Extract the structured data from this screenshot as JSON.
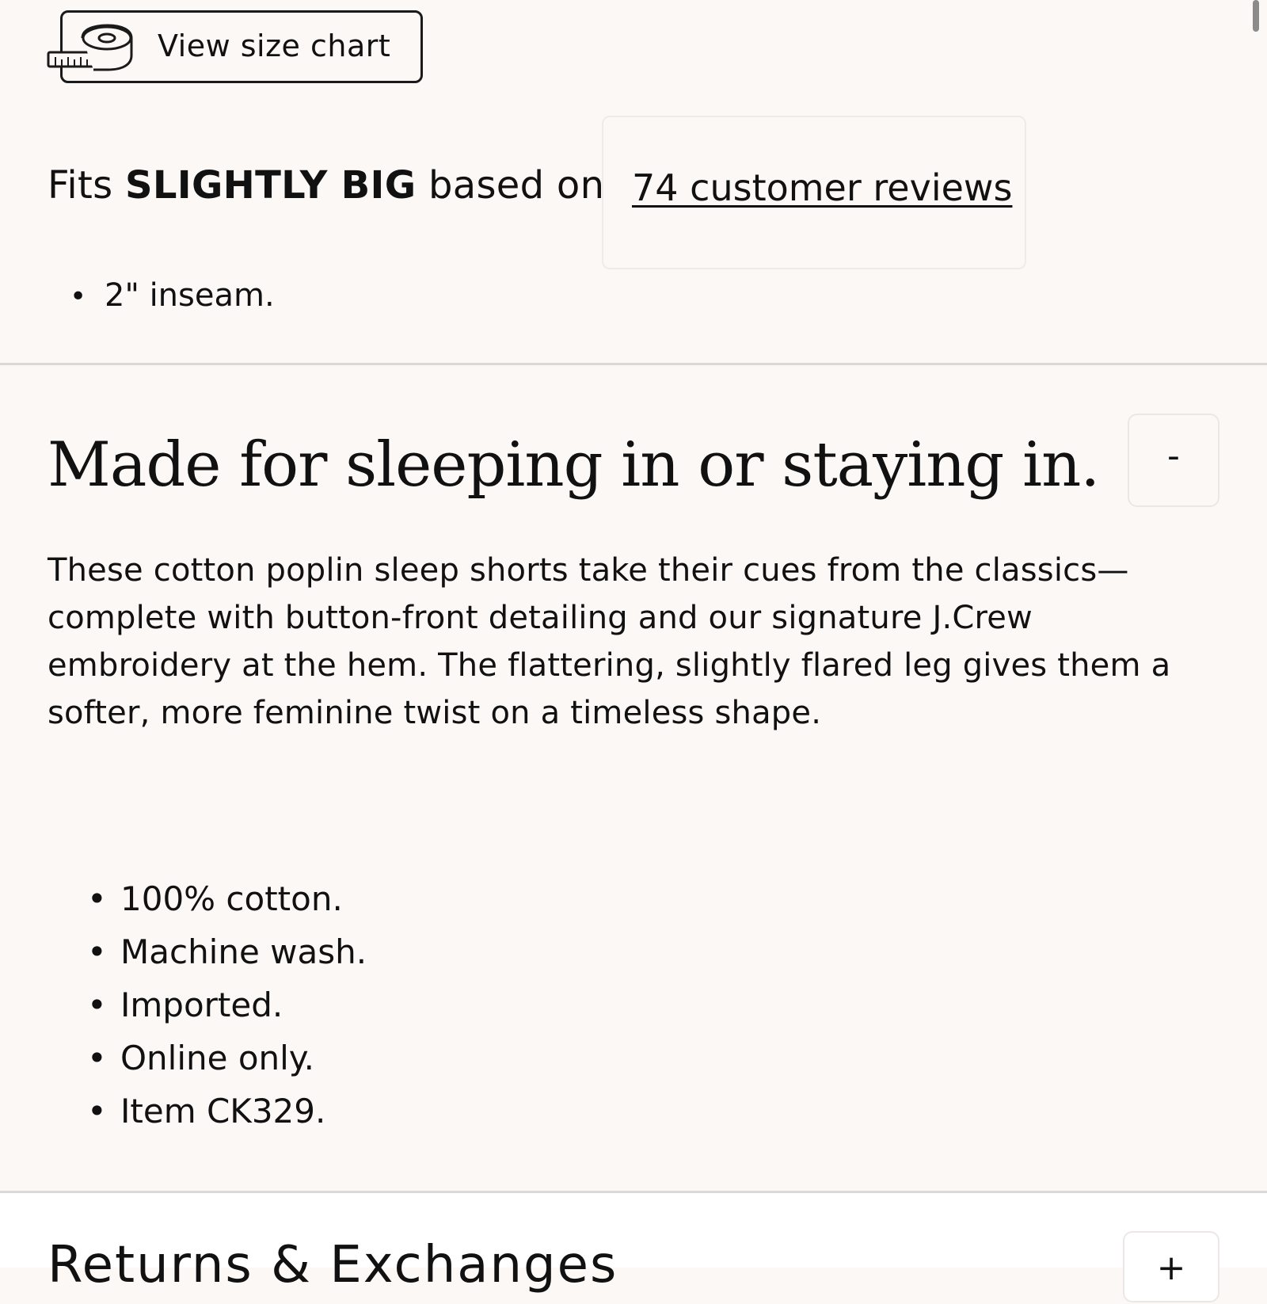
{
  "size_chart": {
    "label": "View size chart",
    "icon": "measuring-tape-icon"
  },
  "fit": {
    "prefix": "Fits",
    "emphasis": "SLIGHTLY BIG",
    "suffix": "based on",
    "reviews_link": "74 customer reviews"
  },
  "fit_details": [
    "2\" inseam."
  ],
  "description_section": {
    "title": "Made for sleeping in or staying in.",
    "toggle": "-",
    "body": "These cotton poplin sleep shorts take their cues from the classics—complete with button-front detailing and our signature J.Crew embroidery at the hem. The flattering, slightly flared leg gives them a softer, more feminine twist on a timeless shape.",
    "features": [
      "100% cotton.",
      "Machine wash.",
      "Imported.",
      "Online only.",
      "Item CK329."
    ]
  },
  "returns_section": {
    "title": "Returns & Exchanges",
    "toggle": "+"
  },
  "colors": {
    "background": "#fcf8f6",
    "text": "#111111",
    "divider": "#dcd8d5"
  }
}
